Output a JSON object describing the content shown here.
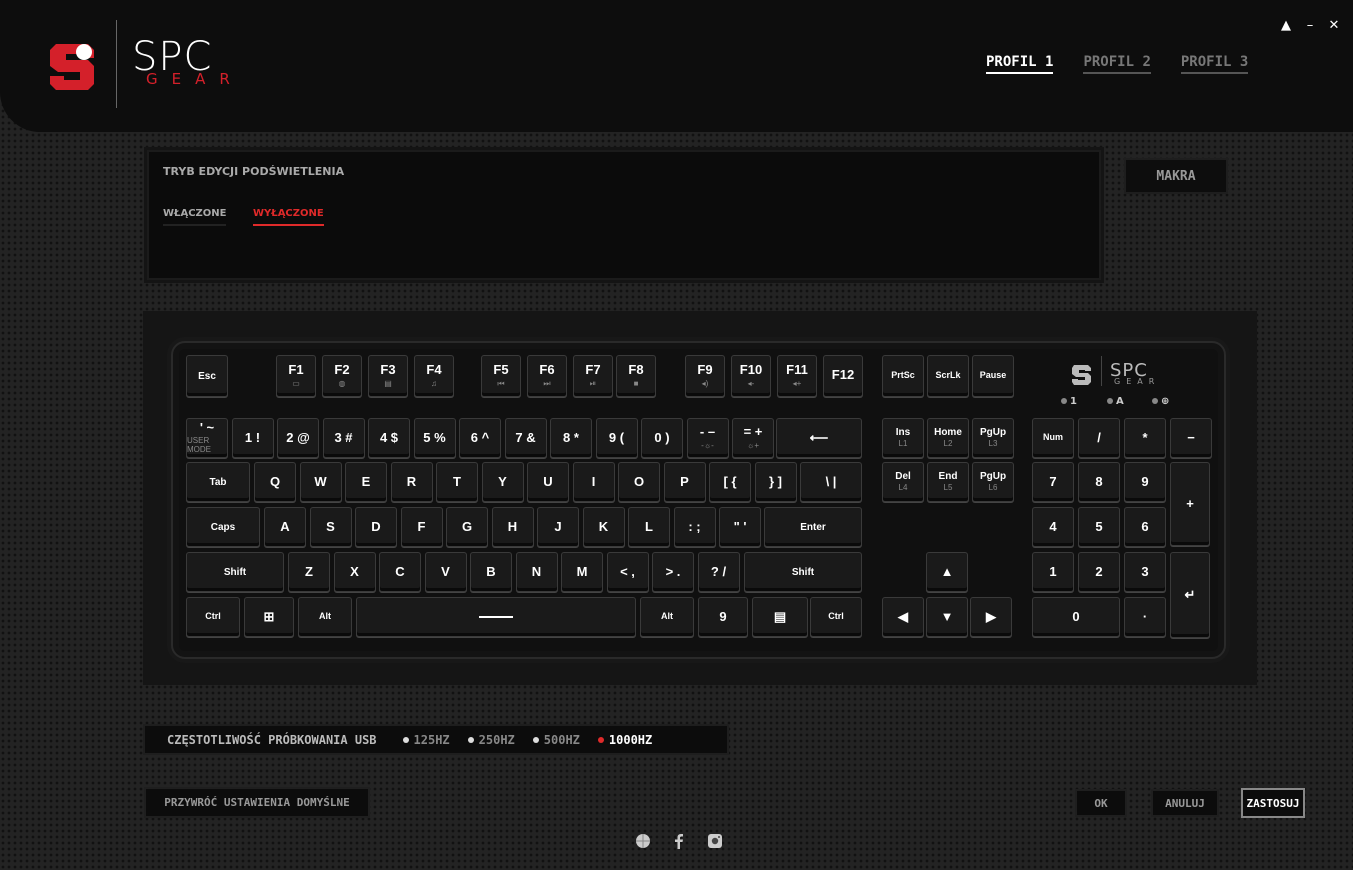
{
  "header": {
    "logo_top": "SPC",
    "logo_bottom": "GEAR",
    "window": {
      "minimize": "▲",
      "min2": "–",
      "close": "✕"
    },
    "profiles": [
      "PROFIL 1",
      "PROFIL 2",
      "PROFIL 3"
    ],
    "active_profile": 0
  },
  "backlight": {
    "title": "TRYB EDYCJI PODŚWIETLENIA",
    "on_label": "WŁĄCZONE",
    "off_label": "WYŁĄCZONE",
    "selected": "off"
  },
  "macros_label": "MAKRA",
  "keyboard_logo": {
    "top": "SPC",
    "bottom": "GEAR"
  },
  "leds": [
    "1",
    "A",
    "⊕"
  ],
  "keys": {
    "esc": "Esc",
    "f": [
      "F1",
      "F2",
      "F3",
      "F4",
      "F5",
      "F6",
      "F7",
      "F8",
      "F9",
      "F10",
      "F11",
      "F12"
    ],
    "f_sub": [
      "▭",
      "◍",
      "▤",
      "♫",
      "⏮",
      "⏭",
      "⏯",
      "■",
      "◂)",
      "◂-",
      "◂+",
      ""
    ],
    "nav_top": [
      "PrtSc",
      "ScrLk",
      "Pause"
    ],
    "num_row": [
      "' ~",
      "1 !",
      "2 @",
      "3 #",
      "4 $",
      "5 %",
      "6 ^",
      "7 &",
      "8 *",
      "9 (",
      "0 )",
      "- –",
      "= +"
    ],
    "num_row_sub": [
      "USER MODE",
      "",
      "",
      "",
      "",
      "",
      "",
      "",
      "",
      "",
      "",
      "-☼-",
      "☼+"
    ],
    "backspace": "⟵",
    "ins": [
      "Ins",
      "Home",
      "PgUp"
    ],
    "ins_sub": [
      "L1",
      "L2",
      "L3"
    ],
    "del": [
      "Del",
      "End",
      "PgUp"
    ],
    "del_sub": [
      "L4",
      "L5",
      "L6"
    ],
    "tab": "Tab",
    "row_q": [
      "Q",
      "W",
      "E",
      "R",
      "T",
      "Y",
      "U",
      "I",
      "O",
      "P",
      "[ {",
      "} ]",
      "\\ |"
    ],
    "caps": "Caps",
    "row_a": [
      "A",
      "S",
      "D",
      "F",
      "G",
      "H",
      "J",
      "K",
      "L",
      ": ;",
      "\" '"
    ],
    "enter": "Enter",
    "shift": "Shift",
    "row_z": [
      "Z",
      "X",
      "C",
      "V",
      "B",
      "N",
      "M",
      "< ,",
      "> .",
      "? /"
    ],
    "ctrl": "Ctrl",
    "win": "⊞",
    "alt": "Alt",
    "fn": "9",
    "menu": "▤",
    "arrows": [
      "▲",
      "◀",
      "▼",
      "▶"
    ],
    "numpad_top": [
      "Num",
      "/",
      "*",
      "−"
    ],
    "numpad": [
      "7",
      "8",
      "9",
      "4",
      "5",
      "6",
      "1",
      "2",
      "3"
    ],
    "plus": "+",
    "numpad_enter": "↵",
    "zero": "0",
    "dot": "·"
  },
  "usb": {
    "label": "CZĘSTOTLIWOŚĆ PRÓBKOWANIA USB",
    "rates": [
      "125HZ",
      "250HZ",
      "500HZ",
      "1000HZ"
    ],
    "selected": 3
  },
  "buttons": {
    "restore": "PRZYWRÓĆ USTAWIENIA DOMYŚLNE",
    "ok": "OK",
    "cancel": "ANULUJ",
    "apply": "ZASTOSUJ"
  },
  "social": [
    "globe-icon",
    "facebook-icon",
    "instagram-icon"
  ]
}
